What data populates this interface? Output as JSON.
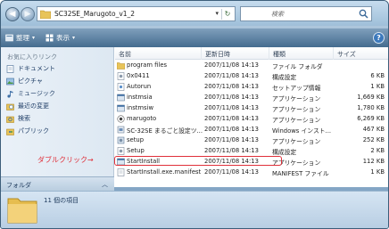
{
  "address": {
    "path": "SC32SE_Marugoto_v1_2",
    "dropdown": "▾",
    "refresh": "↻"
  },
  "search": {
    "placeholder": "検索"
  },
  "nav_buttons": {
    "back": "◀",
    "forward": "▶"
  },
  "toolbar": {
    "organize": "整理",
    "view": "表示",
    "caret": "▾",
    "help": "?"
  },
  "nav": {
    "section": "お気に入りリンク",
    "items": [
      {
        "label": "ドキュメント",
        "icon": "documents-icon"
      },
      {
        "label": "ピクチャ",
        "icon": "pictures-icon"
      },
      {
        "label": "ミュージック",
        "icon": "music-icon"
      },
      {
        "label": "最近の変更",
        "icon": "recent-icon"
      },
      {
        "label": "検索",
        "icon": "search-icon"
      },
      {
        "label": "パブリック",
        "icon": "public-icon"
      }
    ],
    "folders_label": "フォルダ",
    "folders_caret": "︿"
  },
  "columns": {
    "name": "名前",
    "date": "更新日時",
    "type": "種類",
    "size": "サイズ"
  },
  "files": [
    {
      "name": "program files",
      "date": "2007/11/08 14:13",
      "type": "ファイル フォルダ",
      "size": "",
      "icon": "folder-icon"
    },
    {
      "name": "0x0411",
      "date": "2007/11/08 14:13",
      "type": "構成設定",
      "size": "6 KB",
      "icon": "settings-file-icon"
    },
    {
      "name": "Autorun",
      "date": "2007/11/08 14:13",
      "type": "セットアップ情報",
      "size": "1 KB",
      "icon": "setup-info-icon"
    },
    {
      "name": "instmsia",
      "date": "2007/11/08 14:13",
      "type": "アプリケーション",
      "size": "1,669 KB",
      "icon": "app-icon"
    },
    {
      "name": "instmsiw",
      "date": "2007/11/08 14:13",
      "type": "アプリケーション",
      "size": "1,780 KB",
      "icon": "app-icon"
    },
    {
      "name": "marugoto",
      "date": "2007/11/08 14:13",
      "type": "アプリケーション",
      "size": "6,269 KB",
      "icon": "app-icon"
    },
    {
      "name": "SC-32SE まるごと設定ツ...",
      "date": "2007/11/08 14:13",
      "type": "Windows インスト...",
      "size": "467 KB",
      "icon": "installer-icon"
    },
    {
      "name": "setup",
      "date": "2007/11/08 14:13",
      "type": "アプリケーション",
      "size": "252 KB",
      "icon": "setup-app-icon"
    },
    {
      "name": "Setup",
      "date": "2007/11/08 14:13",
      "type": "構成設定",
      "size": "2 KB",
      "icon": "settings-file-icon"
    },
    {
      "name": "StartInstall",
      "date": "2007/11/08 14:13",
      "type": "アプリケーション",
      "size": "112 KB",
      "icon": "app-icon"
    },
    {
      "name": "StartInstall.exe.manifest",
      "date": "2007/11/08 14:13",
      "type": "MANIFEST ファイル",
      "size": "1 KB",
      "icon": "manifest-file-icon"
    }
  ],
  "callout": "ダブルクリック→",
  "details": {
    "count": "11 個の項目"
  },
  "colors": {
    "highlight": "#e0303a",
    "nav_text": "#1f3d66",
    "toolbar": "#456c8f"
  }
}
